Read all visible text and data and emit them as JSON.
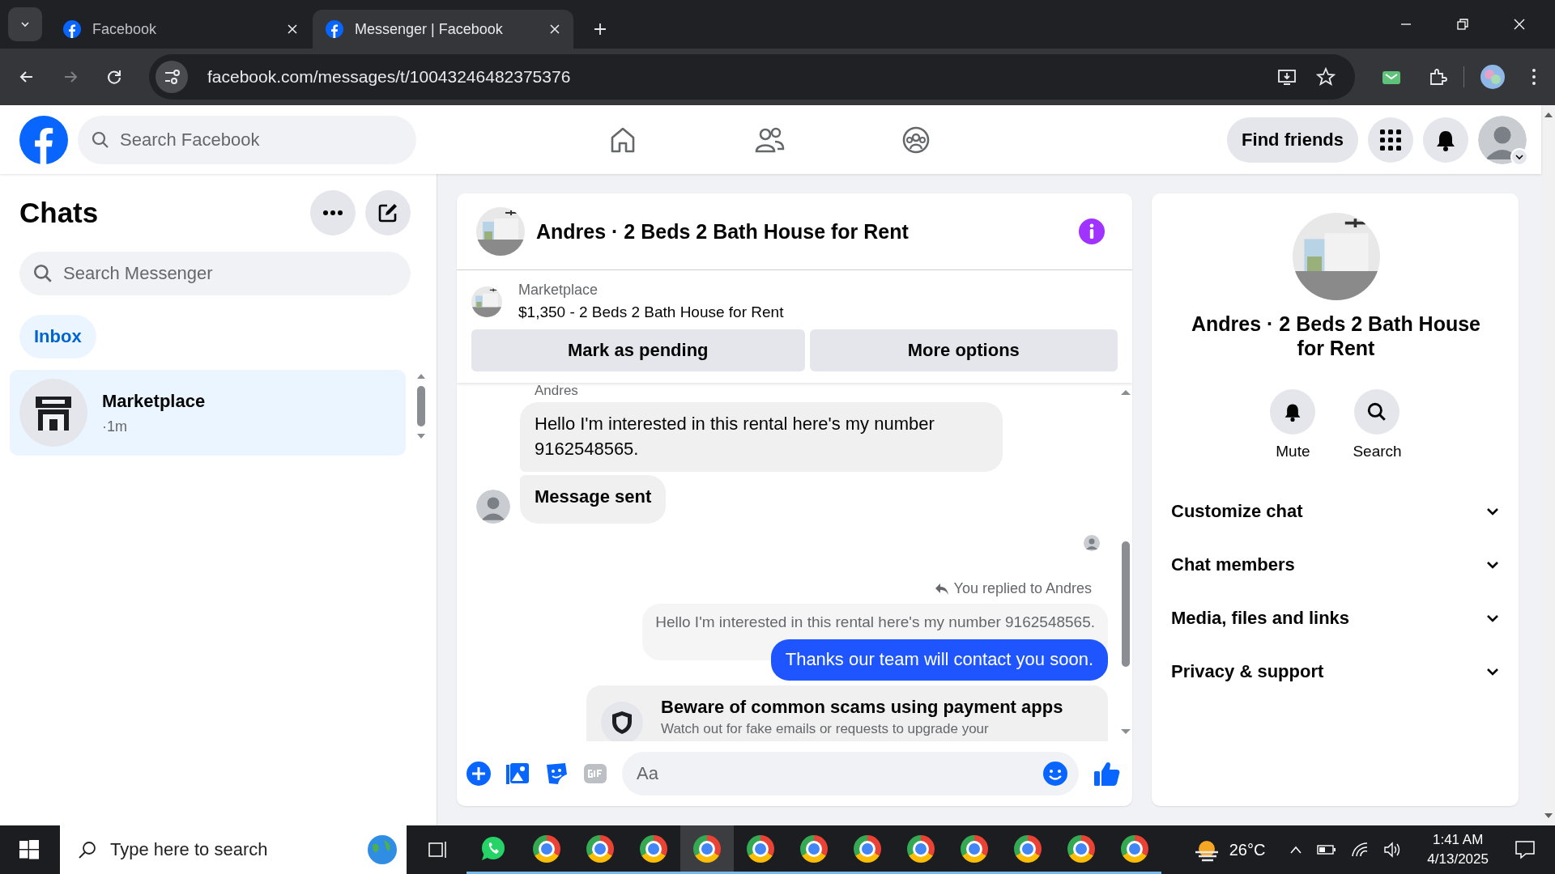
{
  "browser": {
    "tabs": [
      {
        "title": "Facebook",
        "selected": false
      },
      {
        "title": "Messenger | Facebook",
        "selected": true
      }
    ],
    "url": "facebook.com/messages/t/10043246482375376"
  },
  "header": {
    "search_placeholder": "Search Facebook",
    "nav": [
      {
        "kind": "home"
      },
      {
        "kind": "friends"
      },
      {
        "kind": "groups"
      }
    ],
    "find_friends": "Find friends"
  },
  "sidebar": {
    "title": "Chats",
    "search_placeholder": "Search Messenger",
    "filters": [
      {
        "label": "Inbox",
        "selected": true
      }
    ],
    "chats": [
      {
        "name": "Marketplace",
        "time": "·1m",
        "selected": true
      }
    ]
  },
  "conversation": {
    "title": "Andres · 2 Beds 2 Bath House for Rent",
    "listing": {
      "source": "Marketplace",
      "title": "$1,350 - 2 Beds 2 Bath House for Rent"
    },
    "actions": [
      "Mark as pending",
      "More options"
    ],
    "messages": [
      {
        "kind": "sender",
        "text": "Andres"
      },
      {
        "kind": "incoming",
        "text": "Hello I'm interested in this rental here's my number 9162548565.",
        "bold": false,
        "avatar": false
      },
      {
        "kind": "incoming",
        "text": "Message sent",
        "bold": true,
        "avatar": true
      },
      {
        "kind": "seen"
      },
      {
        "kind": "reply_note",
        "text": "You replied to Andres"
      },
      {
        "kind": "quoted",
        "text": "Hello I'm interested in this rental here's my number 9162548565."
      },
      {
        "kind": "outgoing",
        "text": "Thanks our team will contact you soon."
      },
      {
        "kind": "notice",
        "title": "Beware of common scams using payment apps",
        "text": "Watch out for fake emails or requests to upgrade your"
      }
    ],
    "composer_placeholder": "Aa"
  },
  "details": {
    "name": "Andres · 2 Beds 2 Bath House for Rent",
    "actions": [
      {
        "kind": "mute",
        "label": "Mute"
      },
      {
        "kind": "search",
        "label": "Search"
      }
    ],
    "sections": [
      {
        "label": "Customize chat",
        "expanded": false
      },
      {
        "label": "Chat members",
        "expanded": false
      },
      {
        "label": "Media, files and links",
        "expanded": false
      },
      {
        "label": "Privacy & support",
        "expanded": false
      }
    ]
  },
  "taskbar": {
    "search_placeholder": "Type here to search",
    "apps": [
      {
        "kind": "whatsapp",
        "selected": false
      },
      {
        "kind": "chrome",
        "selected": false
      },
      {
        "kind": "chrome",
        "selected": false
      },
      {
        "kind": "chrome",
        "selected": false
      },
      {
        "kind": "chrome",
        "selected": true
      },
      {
        "kind": "chrome",
        "selected": false
      },
      {
        "kind": "chrome",
        "selected": false
      },
      {
        "kind": "chrome",
        "selected": false
      },
      {
        "kind": "chrome",
        "selected": false
      },
      {
        "kind": "chrome",
        "selected": false
      },
      {
        "kind": "chrome",
        "selected": false
      },
      {
        "kind": "chrome",
        "selected": false
      },
      {
        "kind": "chrome",
        "selected": false
      }
    ],
    "weather": "26°C",
    "time": "1:41 AM",
    "date": "4/13/2025"
  }
}
